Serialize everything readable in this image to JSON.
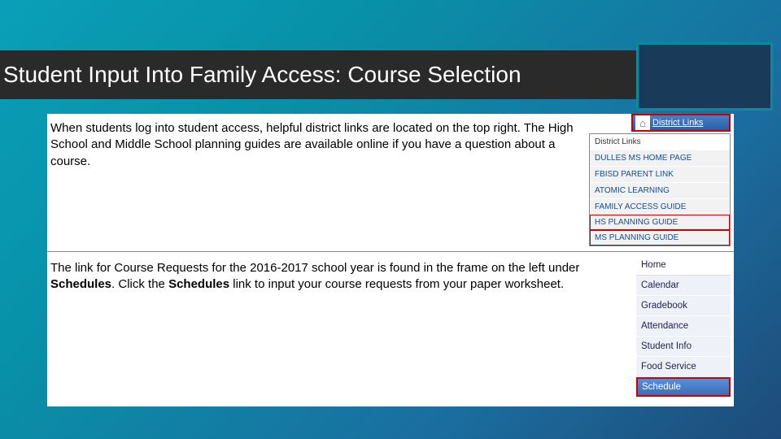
{
  "slide": {
    "title": "Student Input Into Family Access: Course Selection"
  },
  "section1": {
    "paragraph": "When students log into student access, helpful district links are located on the top right. The High School and Middle School planning guides are available online if you have a question about a course.",
    "district_button_label": "District Links",
    "panel_header": "District Links",
    "links": [
      "DULLES MS HOME PAGE",
      "FBISD PARENT LINK",
      "ATOMIC LEARNING",
      "FAMILY ACCESS GUIDE",
      "HS PLANNING GUIDE",
      "MS PLANNING GUIDE"
    ]
  },
  "section2": {
    "paragraph_pre": "The link for Course Requests for the 2016-2017 school year is found in the frame on the left under ",
    "bold1": "Schedules",
    "paragraph_mid": ". Click the ",
    "bold2": "Schedules",
    "paragraph_post": " link to input your course requests from your paper worksheet.",
    "nav": [
      "Home",
      "Calendar",
      "Gradebook",
      "Attendance",
      "Student Info",
      "Food Service",
      "Schedule"
    ]
  }
}
